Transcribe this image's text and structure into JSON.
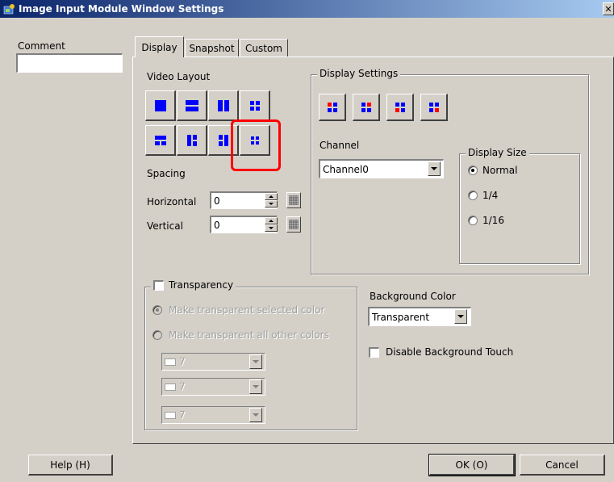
{
  "window": {
    "title": "Image Input Module Window Settings",
    "close_label": "✕"
  },
  "comment": {
    "label": "Comment",
    "value": ""
  },
  "tabs": [
    {
      "label": "Display",
      "active": true
    },
    {
      "label": "Snapshot",
      "active": false
    },
    {
      "label": "Custom",
      "active": false
    }
  ],
  "video_layout": {
    "label": "Video Layout",
    "highlighted_index": 7
  },
  "spacing": {
    "label": "Spacing",
    "horizontal_label": "Horizontal",
    "horizontal_value": "0",
    "vertical_label": "Vertical",
    "vertical_value": "0"
  },
  "display_settings": {
    "label": "Display Settings",
    "channel_label": "Channel",
    "channel_value": "Channel0",
    "display_size": {
      "label": "Display Size",
      "options": [
        "Normal",
        "1/4",
        "1/16"
      ],
      "selected": "Normal"
    }
  },
  "transparency": {
    "label": "Transparency",
    "checked": false,
    "option1": "Make transparent selected color",
    "option2": "Make transparent all other colors",
    "color_values": [
      "7",
      "7",
      "7"
    ]
  },
  "background": {
    "label": "Background Color",
    "value": "Transparent",
    "disable_touch_label": "Disable Background Touch",
    "disable_touch_checked": false
  },
  "footer": {
    "help_label": "Help (H)",
    "ok_label": "OK (O)",
    "cancel_label": "Cancel"
  },
  "colors": {
    "icon_blue": "#0000ff",
    "icon_red": "#ff0000",
    "highlight": "#ff0000",
    "titlebar_start": "#0a246a",
    "titlebar_end": "#a6caf0"
  }
}
